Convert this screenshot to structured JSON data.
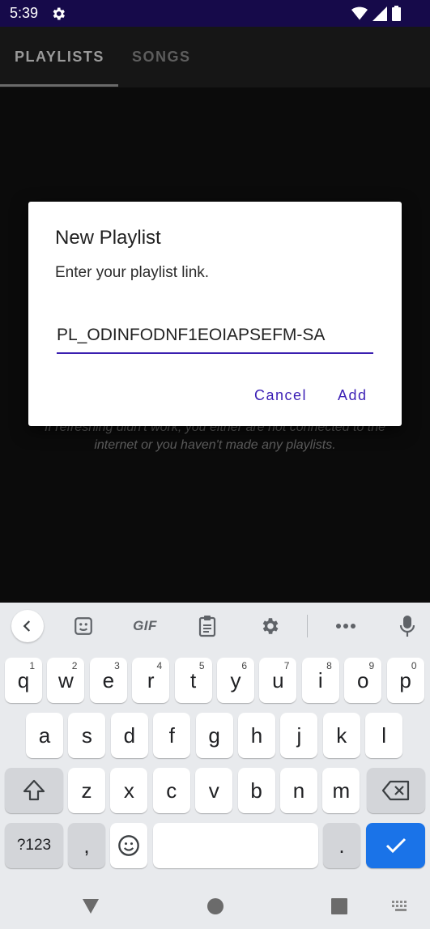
{
  "status_bar": {
    "time": "5:39"
  },
  "tabs": [
    {
      "label": "PLAYLISTS",
      "selected": true
    },
    {
      "label": "SONGS",
      "selected": false
    }
  ],
  "empty_message": "If refreshing didn't work, you either are not connected to the internet or you haven't made any playlists.",
  "dialog": {
    "title": "New Playlist",
    "message": "Enter your playlist link.",
    "input_value": "PL_ODINFODNF1EOIAPSEFM-SA",
    "cancel_label": "Cancel",
    "add_label": "Add"
  },
  "keyboard": {
    "toolbar": [
      "back-icon",
      "sticker-icon",
      "GIF",
      "clipboard-icon",
      "settings-icon",
      "more-icon",
      "mic-icon"
    ],
    "gif_label": "GIF",
    "row1": [
      {
        "k": "q",
        "n": "1"
      },
      {
        "k": "w",
        "n": "2"
      },
      {
        "k": "e",
        "n": "3"
      },
      {
        "k": "r",
        "n": "4"
      },
      {
        "k": "t",
        "n": "5"
      },
      {
        "k": "y",
        "n": "6"
      },
      {
        "k": "u",
        "n": "7"
      },
      {
        "k": "i",
        "n": "8"
      },
      {
        "k": "o",
        "n": "9"
      },
      {
        "k": "p",
        "n": "0"
      }
    ],
    "row2": [
      "a",
      "s",
      "d",
      "f",
      "g",
      "h",
      "j",
      "k",
      "l"
    ],
    "row3": [
      "z",
      "x",
      "c",
      "v",
      "b",
      "n",
      "m"
    ],
    "symbols_label": "?123",
    "comma_label": ",",
    "period_label": ".",
    "colors": {
      "enter": "#1a73e8",
      "accent": "#3b1fb5"
    }
  },
  "nav_bar": [
    "back-triangle-icon",
    "home-circle-icon",
    "recents-square-icon",
    "keyboard-switch-icon"
  ]
}
